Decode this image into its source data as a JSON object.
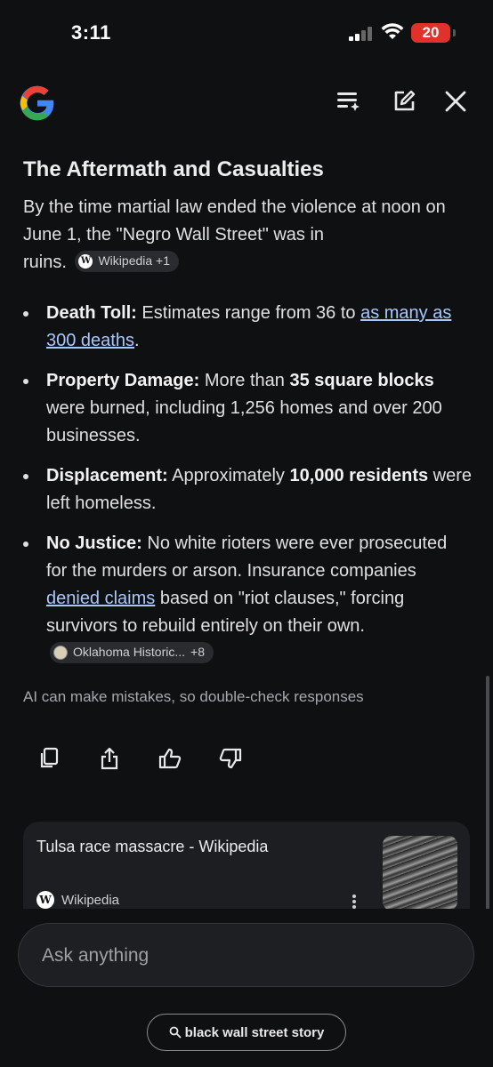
{
  "status_bar": {
    "time": "3:11",
    "battery": "20"
  },
  "content": {
    "heading": "The Aftermath and Casualties",
    "intro": {
      "line1": "By the time martial law ended the violence at noon on",
      "line2": "June 1, the \"Negro Wall Street\" was in",
      "line3": "ruins.",
      "chip": "Wikipedia +1"
    },
    "bullets": [
      {
        "label": "Death Toll:",
        "text": " Estimates range from 36 to ",
        "link": "as many as 300 deaths",
        "tail": "."
      },
      {
        "label": "Property Damage:",
        "text1": " More than ",
        "bold": "35 square blocks",
        "text2": " were burned, including 1,256 homes and over 200 businesses."
      },
      {
        "label": "Displacement:",
        "text1": " Approximately ",
        "bold": "10,000 residents",
        "text2": " were left homeless."
      },
      {
        "label": "No Justice:",
        "text1": " No white rioters were ever prosecuted for the murders or arson. Insurance companies ",
        "link": "denied claims",
        "text2": " based on \"riot clauses,\" forcing survivors to rebuild entirely on their own.",
        "chip_name": "Oklahoma Historic...",
        "chip_count": "+8"
      }
    ],
    "disclaimer": "AI can make mistakes, so double-check responses"
  },
  "actions": [
    "copy-icon",
    "share-icon",
    "thumbs-up-icon",
    "thumbs-down-icon"
  ],
  "source_card": {
    "title": "Tulsa race massacre - Wikipedia",
    "source": "Wikipedia"
  },
  "input": {
    "placeholder": "Ask anything"
  },
  "suggestion": {
    "label": "black wall street story"
  },
  "colors": {
    "background": "#0f1012",
    "link": "#a8c7fa",
    "battery": "#e0312b"
  }
}
